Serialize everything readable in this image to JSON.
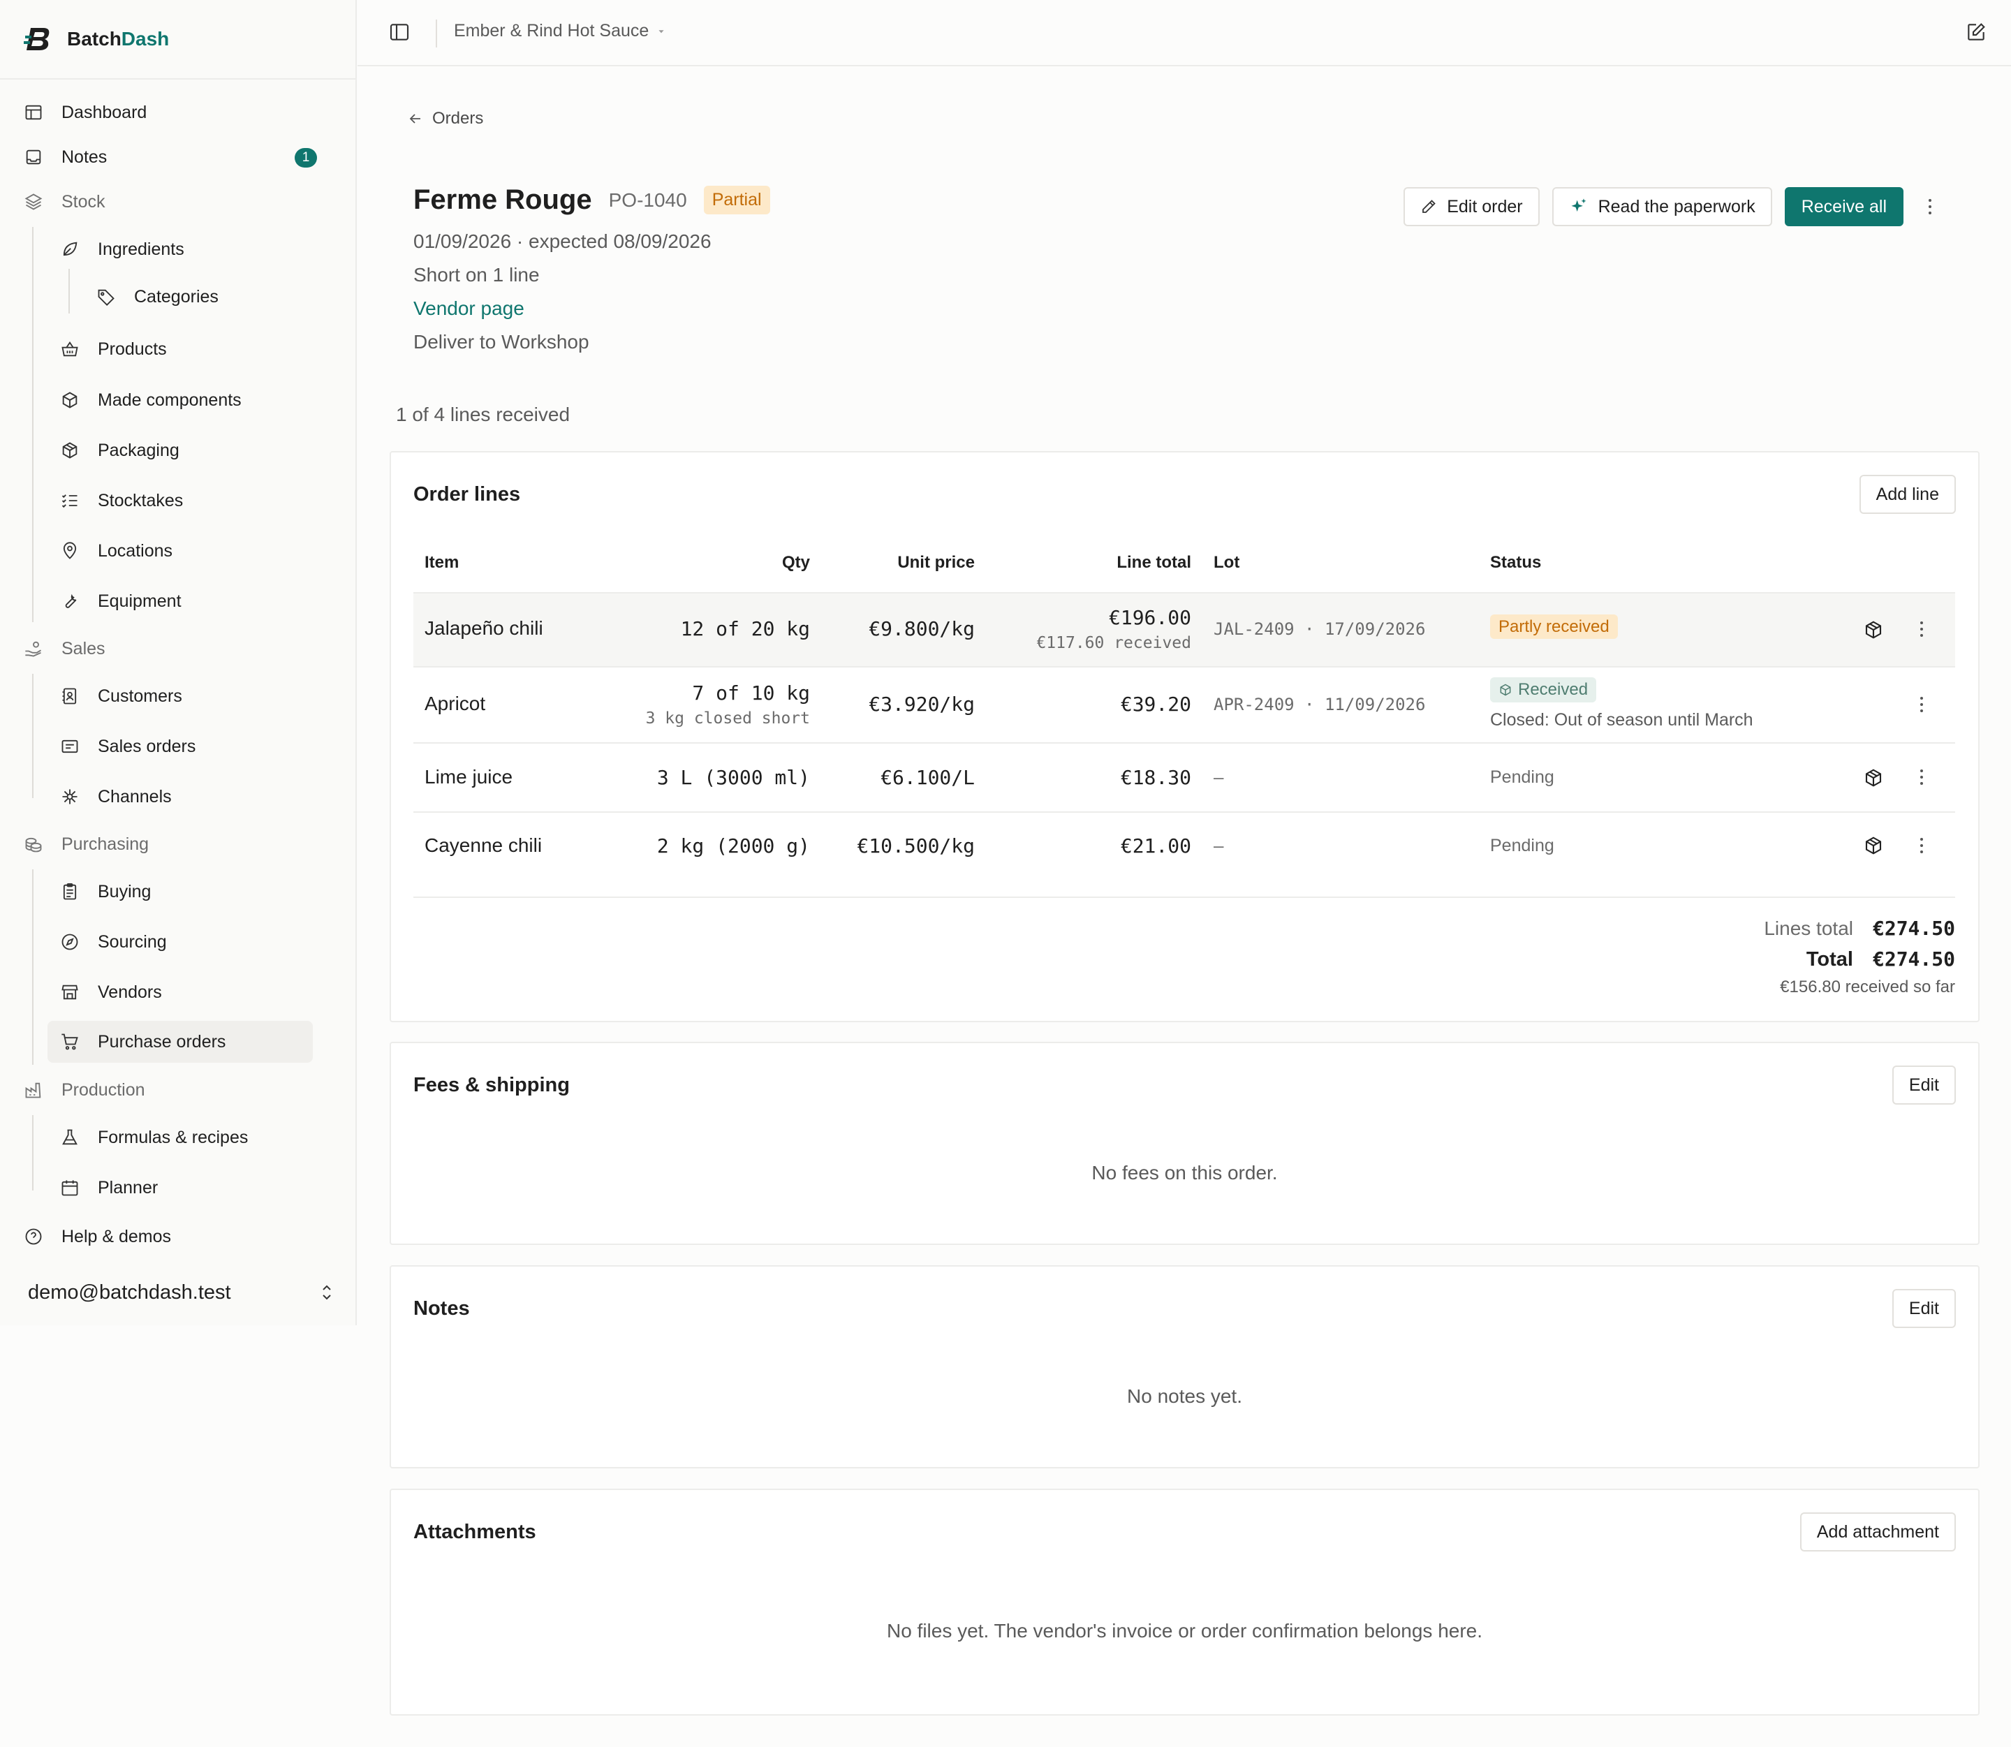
{
  "brand": {
    "name_a": "Batch",
    "name_b": "Dash"
  },
  "sidebar": {
    "dashboard": "Dashboard",
    "notes": "Notes",
    "notes_count": "1",
    "stock": "Stock",
    "ingredients": "Ingredients",
    "categories": "Categories",
    "products": "Products",
    "made_components": "Made components",
    "packaging": "Packaging",
    "stocktakes": "Stocktakes",
    "locations": "Locations",
    "equipment": "Equipment",
    "sales": "Sales",
    "customers": "Customers",
    "sales_orders": "Sales orders",
    "channels": "Channels",
    "purchasing": "Purchasing",
    "buying": "Buying",
    "sourcing": "Sourcing",
    "vendors": "Vendors",
    "purchase_orders": "Purchase orders",
    "production": "Production",
    "formulas": "Formulas & recipes",
    "planner": "Planner",
    "help": "Help & demos",
    "user_email": "demo@batchdash.test"
  },
  "topbar": {
    "company": "Ember & Rind Hot Sauce"
  },
  "page": {
    "back_label": "Orders",
    "vendor": "Ferme Rouge",
    "po_number": "PO-1040",
    "status": "Partial",
    "dates": "01/09/2026 · expected 08/09/2026",
    "short_note": "Short on 1 line",
    "vendor_link": "Vendor page",
    "deliver_to": "Deliver to Workshop",
    "lines_received": "1 of 4 lines received"
  },
  "actions": {
    "edit_order": "Edit order",
    "read_paperwork": "Read the paperwork",
    "receive_all": "Receive all"
  },
  "order_lines": {
    "title": "Order lines",
    "add_line": "Add line",
    "columns": {
      "item": "Item",
      "qty": "Qty",
      "unit_price": "Unit price",
      "line_total": "Line total",
      "lot": "Lot",
      "status": "Status"
    },
    "rows": [
      {
        "item": "Jalapeño chili",
        "qty": "12 of 20 kg",
        "unit_price": "€9.800/kg",
        "line_total": "€196.00",
        "line_total_note": "€117.60 received",
        "lot": "JAL-2409 · 17/09/2026",
        "status": "Partly received"
      },
      {
        "item": "Apricot",
        "qty": "7 of 10 kg",
        "qty_note": "3 kg closed short",
        "unit_price": "€3.920/kg",
        "line_total": "€39.20",
        "lot": "APR-2409 · 11/09/2026",
        "status": "Received",
        "status_note": "Closed: Out of season until March"
      },
      {
        "item": "Lime juice",
        "qty": "3 L (3000 ml)",
        "unit_price": "€6.100/L",
        "line_total": "€18.30",
        "lot": "–",
        "status": "Pending"
      },
      {
        "item": "Cayenne chili",
        "qty": "2 kg (2000 g)",
        "unit_price": "€10.500/kg",
        "line_total": "€21.00",
        "lot": "–",
        "status": "Pending"
      }
    ],
    "lines_total_label": "Lines total",
    "lines_total": "€274.50",
    "total_label": "Total",
    "total": "€274.50",
    "received_so_far": "€156.80 received so far"
  },
  "fees": {
    "title": "Fees & shipping",
    "edit": "Edit",
    "empty": "No fees on this order."
  },
  "notes": {
    "title": "Notes",
    "edit": "Edit",
    "empty": "No notes yet."
  },
  "attachments": {
    "title": "Attachments",
    "add": "Add attachment",
    "empty": "No files yet. The vendor's invoice or order confirmation belongs here."
  },
  "colors": {
    "accent": "#0f766e",
    "warning_bg": "#fde9c9",
    "warning_text": "#c26c08",
    "success_bg": "#e6f0ec"
  }
}
